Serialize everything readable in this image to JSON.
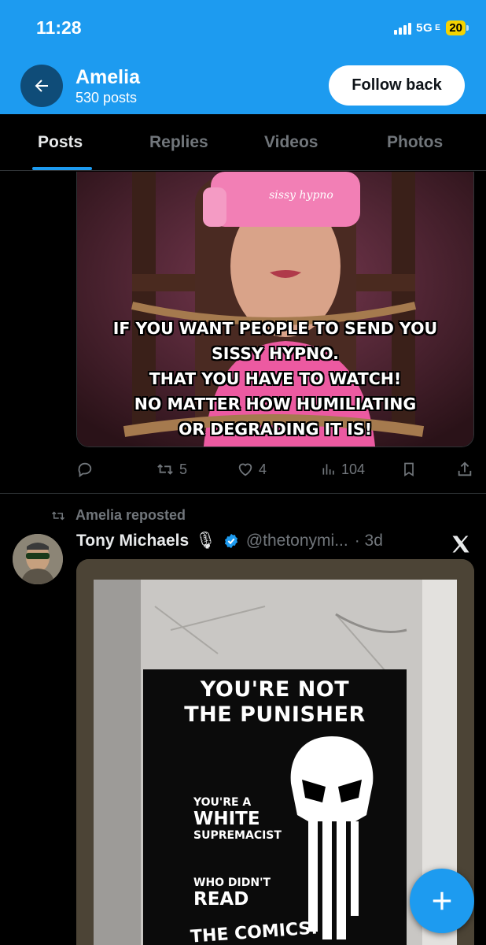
{
  "status_bar": {
    "time": "11:28",
    "network": "5G",
    "network_suffix": "E",
    "battery": "20"
  },
  "profile": {
    "name": "Amelia",
    "post_count": "530 posts",
    "follow_button": "Follow back"
  },
  "tabs": [
    {
      "label": "Posts",
      "active": true
    },
    {
      "label": "Replies",
      "active": false
    },
    {
      "label": "Videos",
      "active": false
    },
    {
      "label": "Photos",
      "active": false
    }
  ],
  "post1": {
    "image_caption_lines": [
      "IF YOU WANT PEOPLE TO SEND YOU",
      "SISSY HYPNO.",
      "THAT YOU HAVE TO WATCH!",
      "NO MATTER HOW HUMILIATING",
      "OR DEGRADING IT IS!"
    ],
    "headset_text": "sissy hypno",
    "actions": {
      "replies": "",
      "reposts": "5",
      "likes": "4",
      "views": "104"
    }
  },
  "post2": {
    "repost_label": "Amelia reposted",
    "author_name": "Tony Michaels",
    "author_emoji": "🎙",
    "handle": "@thetonymi...",
    "time": "· 3d",
    "sticker": {
      "headline": [
        "YOU'RE NOT",
        "THE PUNISHER"
      ],
      "line_a_small": "YOU'RE A",
      "line_a_big": "WHITE",
      "line_a_small2": "SUPREMACIST",
      "line_b_small": "WHO DIDN'T",
      "line_b_big": "READ",
      "line_b_end": "THE COMICS."
    }
  },
  "colors": {
    "accent": "#1d9bf0",
    "background": "#000000",
    "muted": "#71767b",
    "text": "#e7e9ea"
  },
  "icons": [
    "back-arrow-icon",
    "reply-icon",
    "repost-icon",
    "like-icon",
    "views-icon",
    "bookmark-icon",
    "share-icon",
    "verified-icon",
    "x-logo-icon",
    "compose-plus-icon"
  ]
}
